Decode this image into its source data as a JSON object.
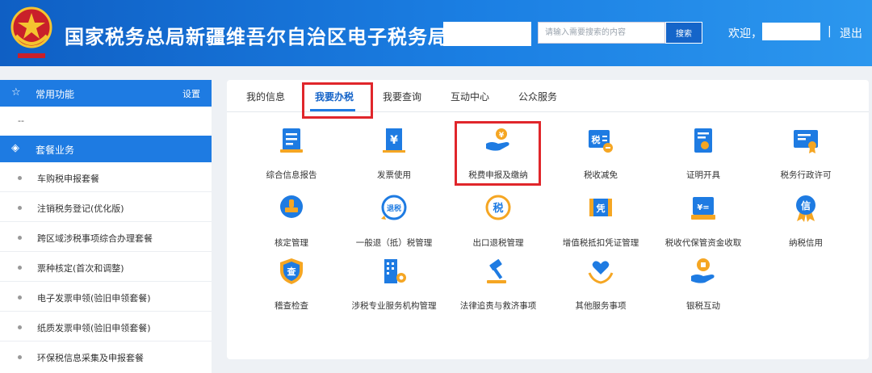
{
  "header": {
    "title": "国家税务总局新疆维吾尔自治区电子税务局",
    "search_placeholder": "请输入需要搜索的内容",
    "search_button": "搜索",
    "welcome": "欢迎，",
    "separator": "|",
    "logout": "退出",
    "colors": {
      "bar_start": "#0f5fc4",
      "bar_end": "#2c97ee"
    }
  },
  "sidebar": {
    "common_header": {
      "icon": "star-icon",
      "label": "常用功能",
      "setting": "设置"
    },
    "common_placeholder": "--",
    "package_header": {
      "icon": "layers-icon",
      "label": "套餐业务"
    },
    "items": [
      {
        "label": "车购税申报套餐"
      },
      {
        "label": "注销税务登记(优化版)"
      },
      {
        "label": "跨区域涉税事项综合办理套餐"
      },
      {
        "label": "票种核定(首次和调整)"
      },
      {
        "label": "电子发票申领(验旧申领套餐)"
      },
      {
        "label": "纸质发票申领(验旧申领套餐)"
      },
      {
        "label": "环保税信息采集及申报套餐"
      }
    ]
  },
  "tabs": [
    {
      "label": "我的信息",
      "active": false
    },
    {
      "label": "我要办税",
      "active": true
    },
    {
      "label": "我要查询",
      "active": false
    },
    {
      "label": "互动中心",
      "active": false
    },
    {
      "label": "公众服务",
      "active": false
    }
  ],
  "services": [
    {
      "label": "综合信息报告",
      "icon": "document-icon",
      "highlighted": false
    },
    {
      "label": "发票使用",
      "icon": "invoice-yuan-icon",
      "highlighted": false
    },
    {
      "label": "税费申报及缴纳",
      "icon": "hand-coin-icon",
      "highlighted": true
    },
    {
      "label": "税收减免",
      "icon": "tax-reduce-icon",
      "icon_text": "税",
      "highlighted": false
    },
    {
      "label": "证明开具",
      "icon": "certificate-icon",
      "highlighted": false
    },
    {
      "label": "税务行政许可",
      "icon": "license-icon",
      "highlighted": false
    },
    {
      "label": "核定管理",
      "icon": "stamp-icon",
      "highlighted": false
    },
    {
      "label": "一般退（抵）税管理",
      "icon": "refund-icon",
      "icon_text": "退税",
      "highlighted": false
    },
    {
      "label": "出口退税管理",
      "icon": "export-refund-icon",
      "icon_text": "税",
      "highlighted": false
    },
    {
      "label": "增值税抵扣凭证管理",
      "icon": "voucher-icon",
      "icon_text": "凭",
      "highlighted": false
    },
    {
      "label": "税收代保管资金收取",
      "icon": "fund-icon",
      "highlighted": false
    },
    {
      "label": "纳税信用",
      "icon": "credit-medal-icon",
      "icon_text": "信",
      "highlighted": false
    },
    {
      "label": "稽查检查",
      "icon": "inspect-shield-icon",
      "icon_text": "查",
      "highlighted": false
    },
    {
      "label": "涉税专业服务机构管理",
      "icon": "building-gear-icon",
      "highlighted": false
    },
    {
      "label": "法律追责与救济事项",
      "icon": "gavel-icon",
      "highlighted": false
    },
    {
      "label": "其他服务事项",
      "icon": "heart-hands-icon",
      "highlighted": false
    },
    {
      "label": "银税互动",
      "icon": "coin-hand-icon",
      "highlighted": false
    }
  ],
  "colors": {
    "accent": "#1e7be2",
    "highlight": "#e0262b",
    "orange": "#f5a623"
  }
}
